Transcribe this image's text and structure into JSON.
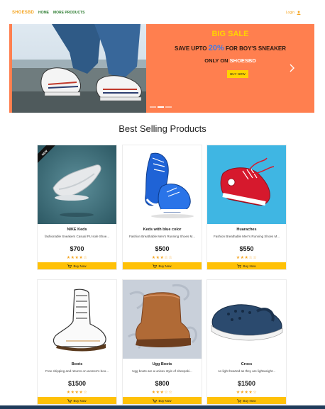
{
  "nav": {
    "brand": "SHOESBD",
    "links": [
      "HOME",
      "MORE PRODUCTS"
    ],
    "login": "Login"
  },
  "hero": {
    "title": "BIG SALE",
    "line1_prefix": "SAVE UPTO ",
    "line1_percent": "20%",
    "line1_suffix": " FOR BOY'S SNEAKER",
    "line2_prefix": "ONLY ON ",
    "line2_brand": "SHOESBD",
    "button": "BUY NOW",
    "next_icon": "chevron-right-icon",
    "slides": 3,
    "active_slide": 1
  },
  "section": {
    "title": "Best Selling Products"
  },
  "products": [
    {
      "name": "NIKE Keds",
      "desc": "fashionable Sneakers Casual PU sole Shoe...",
      "price": "$700",
      "rating": 4.5,
      "stars": "★★★★☆",
      "badge": "NEW",
      "button": "Buy Now"
    },
    {
      "name": "Keds with blue color",
      "desc": "Fashion Breathable Men's Running Shoes M...",
      "price": "$500",
      "rating": 3,
      "stars": "★★★☆☆",
      "button": "Buy Now"
    },
    {
      "name": "Huaraches",
      "desc": "Fashion Breathable Men's Running Shoes M...",
      "price": "$550",
      "rating": 3.5,
      "stars": "★★★☆☆",
      "button": "Buy Now"
    },
    {
      "name": "Boots",
      "desc": "Free shipping and returns on women's boo...",
      "price": "$1500",
      "rating": 4,
      "stars": "★★★★☆",
      "button": "Buy Now"
    },
    {
      "name": "Ugg Boots",
      "desc": "Ugg boots are a unisex style of sheepski...",
      "price": "$800",
      "rating": 3,
      "stars": "★★★☆☆",
      "button": "Buy Now"
    },
    {
      "name": "Crocs",
      "desc": "As light hearted as they are lightweight...",
      "price": "$1500",
      "rating": 4.5,
      "stars": "★★★★☆",
      "button": "Buy Now"
    }
  ],
  "colors": {
    "brand": "#f5a623",
    "nav_link": "#2e7d32",
    "promo_bg": "#ff7f4f",
    "promo_title": "#ffd400",
    "buy_button": "#ffc107"
  }
}
